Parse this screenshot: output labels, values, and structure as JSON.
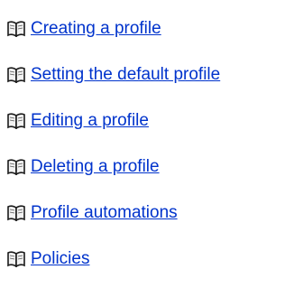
{
  "colors": {
    "link": "#0033cc",
    "icon_outline": "#1a1a1a",
    "icon_page": "#f2f2f2"
  },
  "topics": [
    {
      "label": "Creating a profile",
      "icon": "book-icon"
    },
    {
      "label": "Setting the default profile",
      "icon": "book-icon"
    },
    {
      "label": "Editing a profile",
      "icon": "book-icon"
    },
    {
      "label": "Deleting a profile",
      "icon": "book-icon"
    },
    {
      "label": "Profile automations",
      "icon": "book-icon"
    },
    {
      "label": "Policies",
      "icon": "book-icon"
    }
  ]
}
